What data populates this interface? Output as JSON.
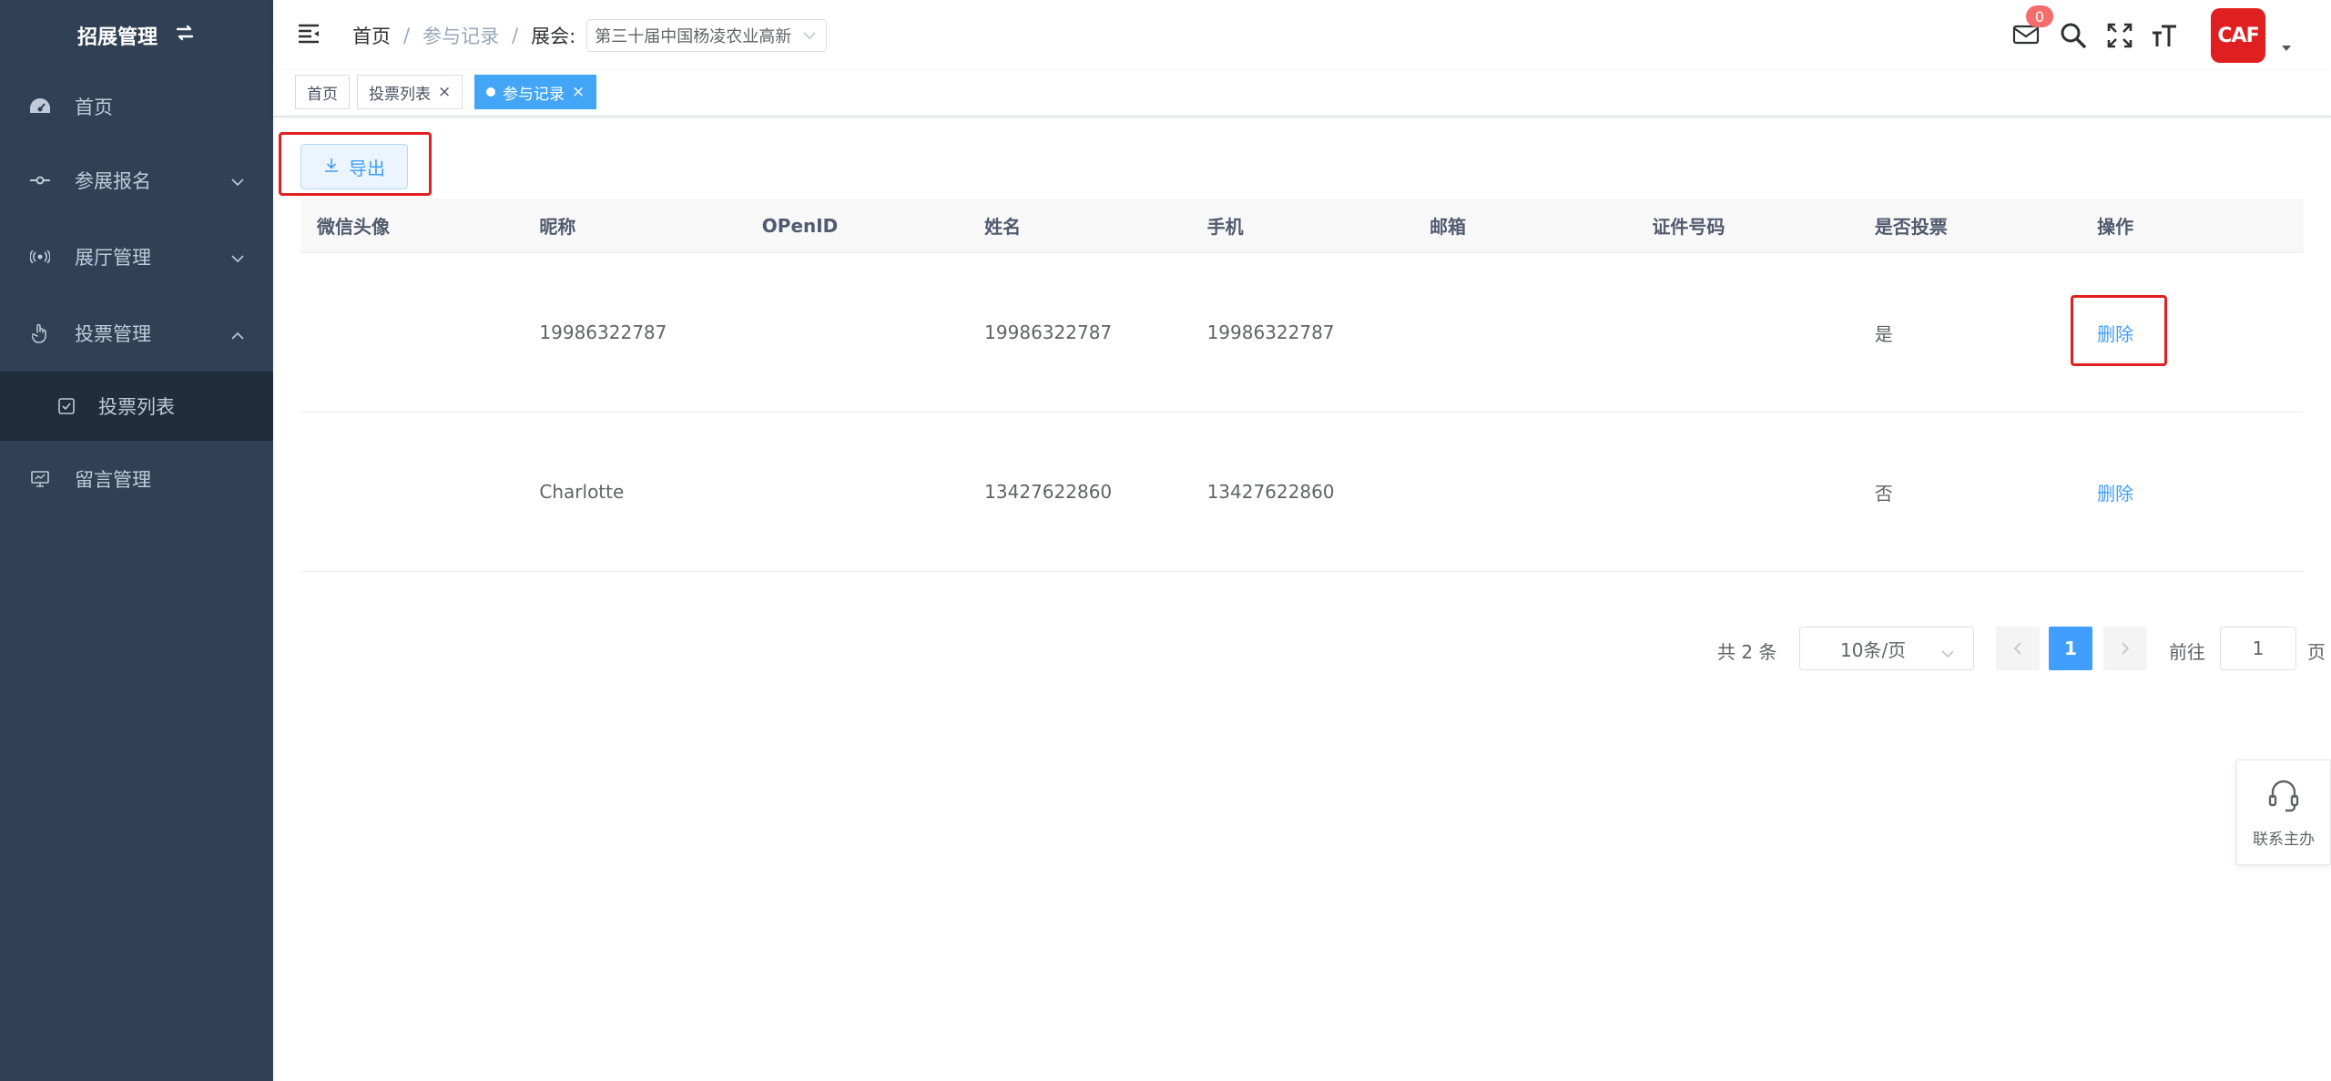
{
  "sidebar": {
    "title": "招展管理",
    "items": [
      {
        "label": "首页"
      },
      {
        "label": "参展报名"
      },
      {
        "label": "展厅管理"
      },
      {
        "label": "投票管理"
      },
      {
        "label": "投票列表"
      },
      {
        "label": "留言管理"
      }
    ]
  },
  "header": {
    "breadcrumb": {
      "home": "首页",
      "sep": "/",
      "current": "参与记录",
      "filter_label": "展会:"
    },
    "exhibition_select": {
      "value": "第三十届中国杨凌农业高新"
    },
    "badge_count": "0",
    "logo_text": "CAF"
  },
  "tags": [
    {
      "label": "首页",
      "active": false
    },
    {
      "label": "投票列表",
      "active": false
    },
    {
      "label": "参与记录",
      "active": true
    }
  ],
  "toolbar": {
    "export_label": "导出"
  },
  "table": {
    "headers": [
      "微信头像",
      "昵称",
      "OPenID",
      "姓名",
      "手机",
      "邮箱",
      "证件号码",
      "是否投票",
      "操作"
    ],
    "rows": [
      {
        "nickname": "19986322787",
        "openid": "",
        "name": "19986322787",
        "phone": "19986322787",
        "email": "",
        "id_number": "",
        "voted": "是",
        "action": "删除"
      },
      {
        "nickname": "Charlotte",
        "openid": "",
        "name": "13427622860",
        "phone": "13427622860",
        "email": "",
        "id_number": "",
        "voted": "否",
        "action": "删除"
      }
    ]
  },
  "pagination": {
    "total": "共 2 条",
    "page_size": "10条/页",
    "current_page": "1",
    "goto_label": "前往",
    "goto_value": "1",
    "page_label": "页"
  },
  "contact": {
    "label": "联系主办"
  },
  "colors": {
    "sidebar_bg": "#304156",
    "primary": "#409eff",
    "tag_active": "#42a5f5",
    "highlight": "#e02020",
    "badge": "#f56c6c"
  }
}
